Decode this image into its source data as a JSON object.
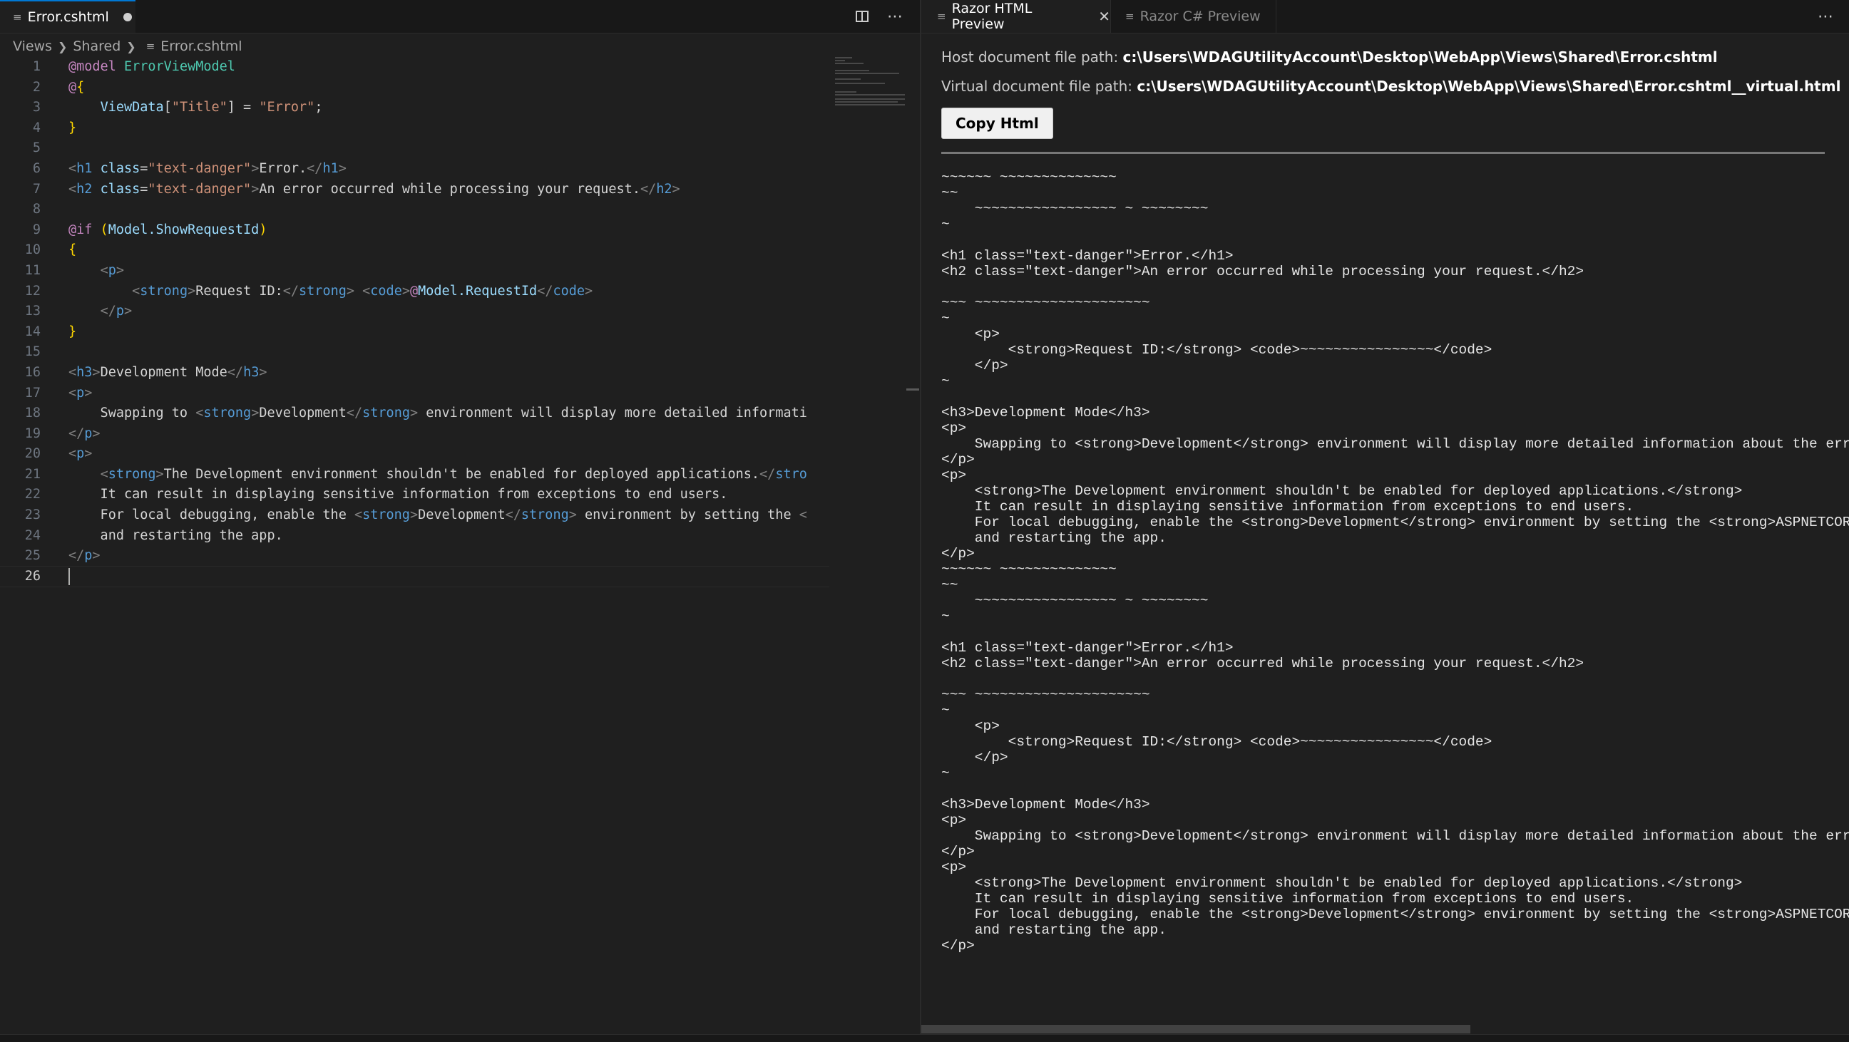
{
  "left_editor": {
    "tab": {
      "icon": "list-icon",
      "title": "Error.cshtml",
      "dirty": true
    },
    "breadcrumb": [
      "Views",
      "Shared",
      "Error.cshtml"
    ],
    "line_numbers": [
      "1",
      "2",
      "3",
      "4",
      "5",
      "6",
      "7",
      "8",
      "9",
      "10",
      "11",
      "12",
      "13",
      "14",
      "15",
      "16",
      "17",
      "18",
      "19",
      "20",
      "21",
      "22",
      "23",
      "24",
      "25",
      "26"
    ],
    "current_line": 26
  },
  "right_editor": {
    "tabs": [
      {
        "icon": "list-icon",
        "title": "Razor HTML Preview",
        "active": true
      },
      {
        "icon": "list-icon",
        "title": "Razor C# Preview",
        "active": false
      }
    ],
    "host_label": "Host document file path:",
    "host_path": "c:\\Users\\WDAGUtilityAccount\\Desktop\\WebApp\\Views\\Shared\\Error.cshtml",
    "virtual_label": "Virtual document file path:",
    "virtual_path": "c:\\Users\\WDAGUtilityAccount\\Desktop\\WebApp\\Views\\Shared\\Error.cshtml__virtual.html",
    "copy_button": "Copy Html",
    "html_output": "~~~~~~ ~~~~~~~~~~~~~~\n~~\n    ~~~~~~~~~~~~~~~~~ ~ ~~~~~~~~\n~\n\n<h1 class=\"text-danger\">Error.</h1>\n<h2 class=\"text-danger\">An error occurred while processing your request.</h2>\n\n~~~ ~~~~~~~~~~~~~~~~~~~~~\n~\n    <p>\n        <strong>Request ID:</strong> <code>~~~~~~~~~~~~~~~~</code>\n    </p>\n~\n\n<h3>Development Mode</h3>\n<p>\n    Swapping to <strong>Development</strong> environment will display more detailed information about the error that occurred.\n</p>\n<p>\n    <strong>The Development environment shouldn't be enabled for deployed applications.</strong>\n    It can result in displaying sensitive information from exceptions to end users.\n    For local debugging, enable the <strong>Development</strong> environment by setting the <strong>ASPNETCORE_ENVIRONMENT</strong> environment variable to <strong>Development</strong>\n    and restarting the app.\n</p>\n~~~~~~ ~~~~~~~~~~~~~~\n~~\n    ~~~~~~~~~~~~~~~~~ ~ ~~~~~~~~\n~\n\n<h1 class=\"text-danger\">Error.</h1>\n<h2 class=\"text-danger\">An error occurred while processing your request.</h2>\n\n~~~ ~~~~~~~~~~~~~~~~~~~~~\n~\n    <p>\n        <strong>Request ID:</strong> <code>~~~~~~~~~~~~~~~~</code>\n    </p>\n~\n\n<h3>Development Mode</h3>\n<p>\n    Swapping to <strong>Development</strong> environment will display more detailed information about the error that occurred.\n</p>\n<p>\n    <strong>The Development environment shouldn't be enabled for deployed applications.</strong>\n    It can result in displaying sensitive information from exceptions to end users.\n    For local debugging, enable the <strong>Development</strong> environment by setting the <strong>ASPNETCORE_ENVIRONMENT</strong> environment variable to <strong>Development</strong>\n    and restarting the app.\n</p>"
  },
  "code": {
    "l1": {
      "a": "@model",
      "b": " ErrorViewModel"
    },
    "l2": {
      "a": "@",
      "b": "{"
    },
    "l3": {
      "a": "    ",
      "b": "ViewData",
      "c": "[",
      "d": "\"Title\"",
      "e": "] = ",
      "f": "\"Error\"",
      "g": ";"
    },
    "l4": {
      "a": "}"
    },
    "l6": {
      "a": "<",
      "b": "h1",
      "c": " ",
      "d": "class",
      "e": "=",
      "f": "\"text-danger\"",
      "g": ">",
      "h": "Error.",
      "i": "</",
      "j": "h1",
      "k": ">"
    },
    "l7": {
      "a": "<",
      "b": "h2",
      "c": " ",
      "d": "class",
      "e": "=",
      "f": "\"text-danger\"",
      "g": ">",
      "h": "An error occurred while processing your request.",
      "i": "</",
      "j": "h2",
      "k": ">"
    },
    "l9": {
      "a": "@if",
      "b": " (",
      "c": "Model.ShowRequestId",
      "d": ")"
    },
    "l10": {
      "a": "{"
    },
    "l11": {
      "a": "    ",
      "b": "<",
      "c": "p",
      "d": ">"
    },
    "l12": {
      "a": "        ",
      "b": "<",
      "c": "strong",
      "d": ">",
      "e": "Request ID:",
      "f": "</",
      "g": "strong",
      "h": ">",
      "i": " ",
      "j": "<",
      "k": "code",
      "l": ">",
      "m": "@",
      "n": "Model.RequestId",
      "o": "</",
      "p": "code",
      "q": ">"
    },
    "l13": {
      "a": "    ",
      "b": "</",
      "c": "p",
      "d": ">"
    },
    "l14": {
      "a": "}"
    },
    "l16": {
      "a": "<",
      "b": "h3",
      "c": ">",
      "d": "Development Mode",
      "e": "</",
      "f": "h3",
      "g": ">"
    },
    "l17": {
      "a": "<",
      "b": "p",
      "c": ">"
    },
    "l18": {
      "a": "    Swapping to ",
      "b": "<",
      "c": "strong",
      "d": ">",
      "e": "Development",
      "f": "</",
      "g": "strong",
      "h": ">",
      "i": " environment will display more detailed informati"
    },
    "l19": {
      "a": "</",
      "b": "p",
      "c": ">"
    },
    "l20": {
      "a": "<",
      "b": "p",
      "c": ">"
    },
    "l21": {
      "a": "    ",
      "b": "<",
      "c": "strong",
      "d": ">",
      "e": "The Development environment shouldn't be enabled for deployed applications.",
      "f": "</",
      "g": "stro"
    },
    "l22": {
      "a": "    It can result in displaying sensitive information from exceptions to end users."
    },
    "l23": {
      "a": "    For local debugging, enable the ",
      "b": "<",
      "c": "strong",
      "d": ">",
      "e": "Development",
      "f": "</",
      "g": "strong",
      "h": ">",
      "i": " environment by setting the ",
      "j": "<"
    },
    "l24": {
      "a": "    and restarting the app."
    },
    "l25": {
      "a": "</",
      "b": "p",
      "c": ">"
    }
  },
  "colors": {
    "accent": "#0078d4",
    "background": "#1f1f1f",
    "tab_bar": "#181818",
    "button": "#f0f0f0"
  }
}
